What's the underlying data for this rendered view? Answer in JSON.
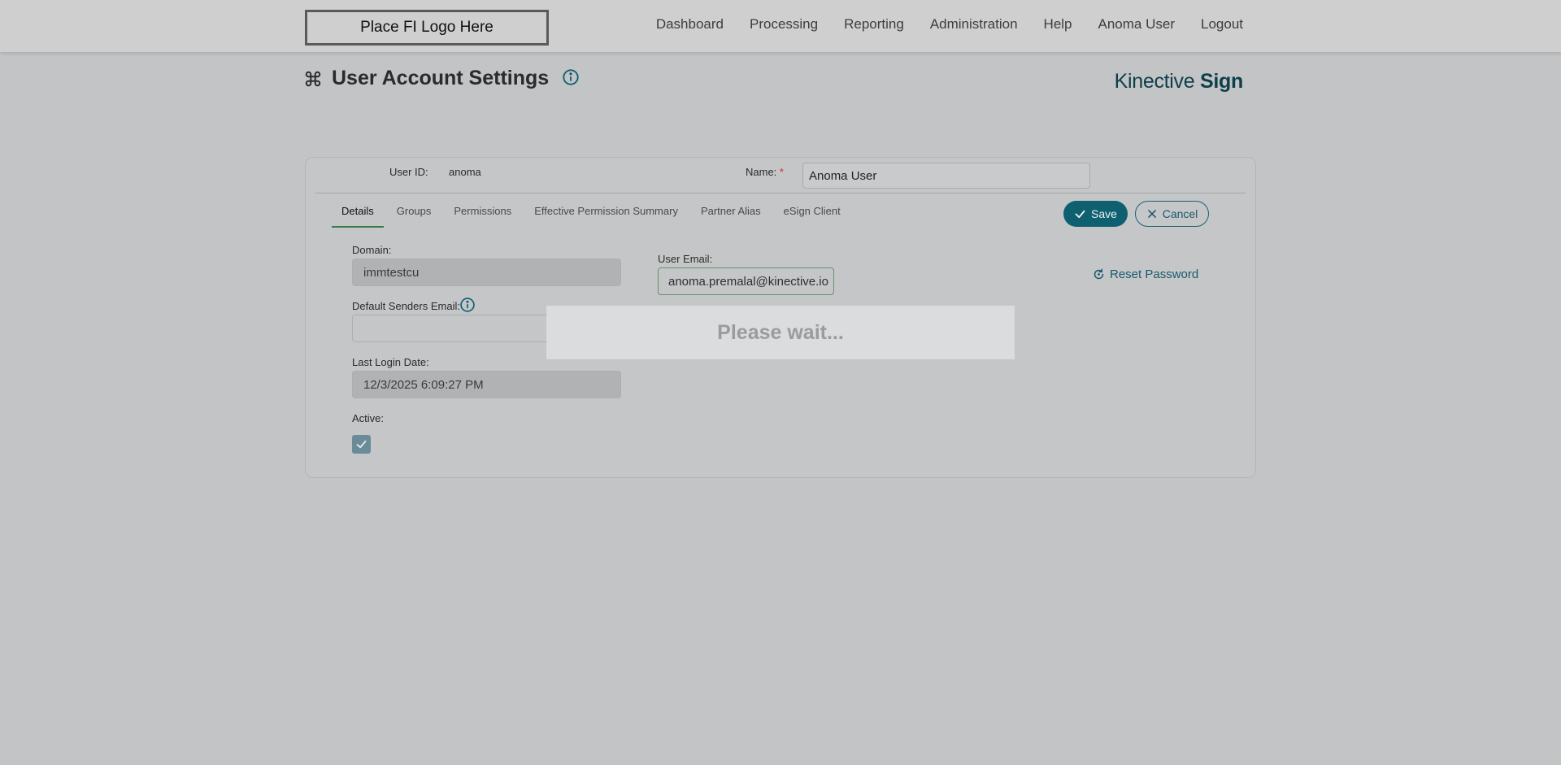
{
  "header": {
    "logo_text": "Place FI Logo Here",
    "nav": [
      "Dashboard",
      "Processing",
      "Reporting",
      "Administration",
      "Help",
      "Anoma User",
      "Logout"
    ]
  },
  "page": {
    "title": "User Account Settings",
    "brand_light": "Kinective",
    "brand_bold": "Sign"
  },
  "form": {
    "user_id_label": "User ID:",
    "user_id_value": "anoma",
    "name_label": "Name:",
    "name_required": "*",
    "name_value": "Anoma User",
    "tabs": [
      "Details",
      "Groups",
      "Permissions",
      "Effective Permission Summary",
      "Partner Alias",
      "eSign Client"
    ],
    "active_tab": "Details",
    "save_label": "Save",
    "cancel_label": "Cancel",
    "domain_label": "Domain:",
    "domain_value": "immtestcu",
    "user_email_label": "User Email:",
    "user_email_value": "anoma.premalal@kinective.io",
    "default_senders_label": "Default Senders Email:",
    "default_senders_value": "",
    "last_login_label": "Last Login Date:",
    "last_login_value": "12/3/2025 6:09:27 PM",
    "active_label": "Active:",
    "active_checked": true,
    "reset_password_label": "Reset Password"
  },
  "overlay": {
    "text": "Please wait..."
  },
  "colors": {
    "accent": "#0e5f70",
    "brand_text": "#0e3f4a",
    "active_tab_underline": "#3c7a4a",
    "required": "#c0392b"
  },
  "icons": {
    "title_icon": "command-icon",
    "info_icon": "info-circle-icon",
    "save_icon": "check-icon",
    "cancel_icon": "close-icon",
    "reset_icon": "refresh-icon",
    "checkbox_icon": "check-icon"
  }
}
